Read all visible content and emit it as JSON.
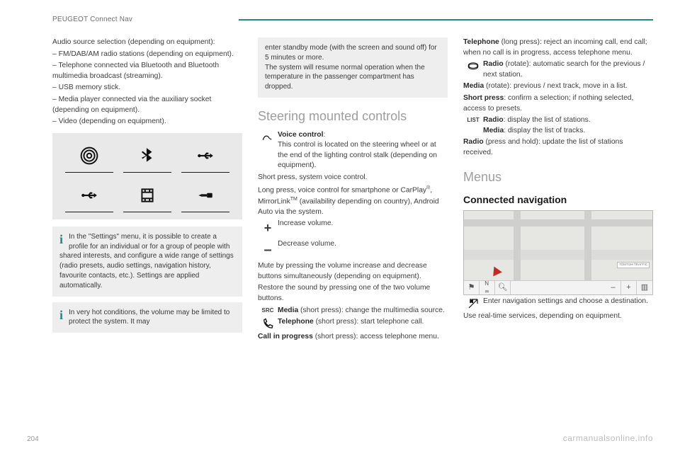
{
  "header": {
    "title": "PEUGEOT Connect Nav"
  },
  "page_number": "204",
  "watermark": "carmanualsonline.info",
  "col1": {
    "p1": "Audio source selection (depending on equipment):",
    "li1": "FM/DAB/AM radio stations (depending on equipment).",
    "li2": "Telephone connected via Bluetooth and Bluetooth multimedia broadcast (streaming).",
    "li3": "USB memory stick.",
    "li4": "Media player connected via the auxiliary socket (depending on equipment).",
    "li5": "Video (depending on equipment).",
    "note1": "In the \"Settings\" menu, it is possible to create a profile for an individual or for a group of people with shared interests, and configure a wide range of settings (radio presets, audio settings, navigation history, favourite contacts, etc.). Settings are applied automatically.",
    "note2": "In very hot conditions, the volume may be limited to protect the system. It may",
    "icons": [
      "radio-icon",
      "bluetooth-icon",
      "usb-icon",
      "usb-icon",
      "film-icon",
      "jack-icon"
    ]
  },
  "col2": {
    "note_top": "enter standby mode (with the screen and sound off) for 5 minutes or more.\nThe system will resume normal operation when the temperature in the passenger compartment has dropped.",
    "section": "Steering mounted controls",
    "voice_label": "Voice control",
    "voice_text": "This control is located on the steering wheel or at the end of the lighting control stalk (depending on equipment).",
    "voice_short": "Short press, system voice control.",
    "voice_long_a": "Long press, voice control for smartphone or CarPlay",
    "voice_long_b": ", MirrorLink",
    "voice_long_c": " (availability depending on country), Android Auto via the system.",
    "inc": "Increase volume.",
    "dec": "Decrease volume.",
    "mute": "Mute by pressing the volume increase and decrease buttons simultaneously (depending on equipment).",
    "restore": "Restore the sound by pressing one of the two volume buttons.",
    "src_label": "SRC",
    "media_short_bold": "Media",
    "media_short": " (short press): change the multimedia source.",
    "phone_short_bold": "Telephone",
    "phone_short": " (short press): start telephone call.",
    "call_bold": "Call in progress",
    "call_text": " (short press): access telephone menu."
  },
  "col3": {
    "tel_bold": "Telephone",
    "tel_text": " (long press): reject an incoming call, end call; when no call is in progress, access telephone menu.",
    "radio_rot_bold": "Radio",
    "radio_rot_text": " (rotate): automatic search for the previous / next station.",
    "media_rot_bold": "Media",
    "media_rot_text": " (rotate): previous / next track, move in a list.",
    "short_press_bold": "Short press",
    "short_press_text": ": confirm a selection; if nothing selected, access to presets.",
    "list_label": "LIST",
    "list_radio_bold": "Radio",
    "list_radio_text": ": display the list of stations.",
    "list_media_bold": "Media",
    "list_media_text": ": display the list of tracks.",
    "radio_hold_bold": "Radio",
    "radio_hold_text": " (press and hold): update the list of stations received.",
    "menus": "Menus",
    "connected_nav": "Connected navigation",
    "nav_enter": "Enter navigation settings and choose a destination.",
    "nav_use": "Use real-time services, depending on equipment.",
    "map_badge": "TOMTOM TRAFFIC"
  }
}
